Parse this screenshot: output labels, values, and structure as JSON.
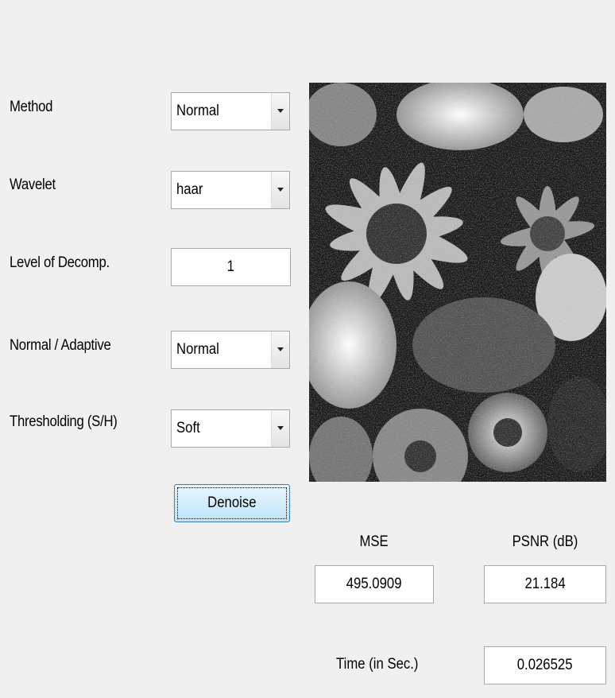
{
  "form": {
    "method": {
      "label": "Method",
      "value": "Normal"
    },
    "wavelet": {
      "label": "Wavelet",
      "value": "haar"
    },
    "level": {
      "label": "Level of Decomp.",
      "value": "1"
    },
    "mode": {
      "label": "Normal / Adaptive",
      "value": "Normal"
    },
    "threshold": {
      "label": "Thresholding (S/H)",
      "value": "Soft"
    },
    "denoise_label": "Denoise"
  },
  "results": {
    "mse_label": "MSE",
    "mse_value": "495.0909",
    "psnr_label": "PSNR (dB)",
    "psnr_value": "21.184",
    "time_label": "Time (in Sec.)",
    "time_value": "0.026525"
  },
  "colors": {
    "background": "#f0f0f0",
    "button_top": "#eaf6fd",
    "button_bottom": "#bee6fd",
    "button_border": "#3c7fb1"
  }
}
